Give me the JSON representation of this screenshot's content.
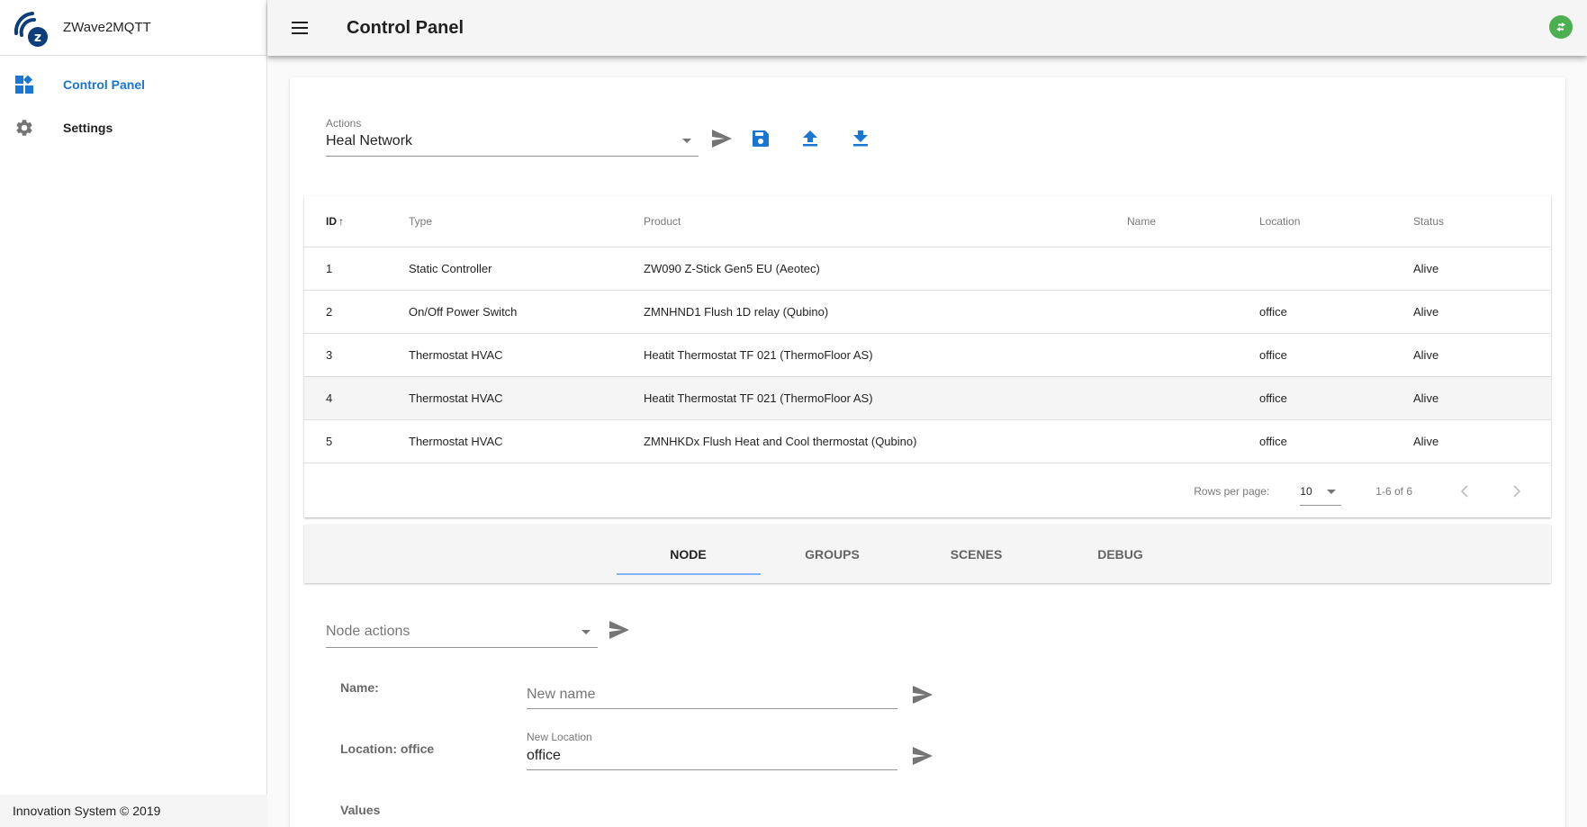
{
  "app": {
    "name": "ZWave2MQTT",
    "footer": "Innovation System © 2019"
  },
  "sidebar": {
    "items": [
      {
        "label": "Control Panel",
        "icon": "dashboard-icon",
        "active": true
      },
      {
        "label": "Settings",
        "icon": "gear-icon",
        "active": false
      }
    ]
  },
  "header": {
    "title": "Control Panel",
    "status_icon": "swap-horizontal-icon",
    "status_color": "#4caf50"
  },
  "actions": {
    "label": "Actions",
    "selected": "Heal Network"
  },
  "table": {
    "columns": [
      "ID",
      "Type",
      "Product",
      "Name",
      "Location",
      "Status"
    ],
    "sort_column": "ID",
    "sort_direction": "ascending",
    "rows": [
      {
        "id": "1",
        "type": "Static Controller",
        "product": "ZW090 Z-Stick Gen5 EU (Aeotec)",
        "name": "",
        "location": "",
        "status": "Alive"
      },
      {
        "id": "2",
        "type": "On/Off Power Switch",
        "product": "ZMNHND1 Flush 1D relay (Qubino)",
        "name": "",
        "location": "office",
        "status": "Alive"
      },
      {
        "id": "3",
        "type": "Thermostat HVAC",
        "product": "Heatit Thermostat TF 021 (ThermoFloor AS)",
        "name": "",
        "location": "office",
        "status": "Alive"
      },
      {
        "id": "4",
        "type": "Thermostat HVAC",
        "product": "Heatit Thermostat TF 021 (ThermoFloor AS)",
        "name": "",
        "location": "office",
        "status": "Alive"
      },
      {
        "id": "5",
        "type": "Thermostat HVAC",
        "product": "ZMNHKDx Flush Heat and Cool thermostat (Qubino)",
        "name": "",
        "location": "office",
        "status": "Alive"
      }
    ],
    "pagination": {
      "rows_per_page_label": "Rows per page:",
      "rows_per_page": "10",
      "range": "1-6 of 6"
    }
  },
  "tabs": [
    {
      "label": "NODE",
      "active": true
    },
    {
      "label": "GROUPS",
      "active": false
    },
    {
      "label": "SCENES",
      "active": false
    },
    {
      "label": "DEBUG",
      "active": false
    }
  ],
  "node_panel": {
    "node_actions_placeholder": "Node actions",
    "name_label": "Name:",
    "name_placeholder": "New name",
    "name_value": "",
    "location_label": "Location: office",
    "location_field_label": "New Location",
    "location_value": "office",
    "values_label": "Values"
  },
  "colors": {
    "accent": "#1976d2",
    "tab_indicator": "#82b1ff",
    "status_ok": "#4caf50"
  }
}
